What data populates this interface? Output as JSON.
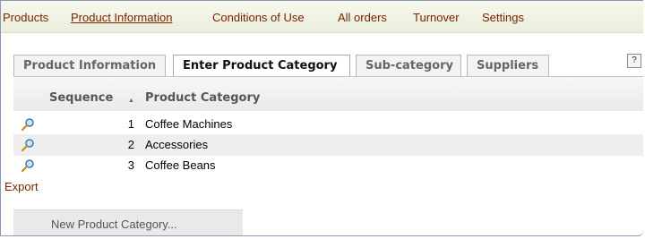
{
  "topnav": {
    "items": [
      {
        "label": "Products"
      },
      {
        "label": "Product Information"
      },
      {
        "label": "Conditions of Use"
      },
      {
        "label": "All orders"
      },
      {
        "label": "Turnover"
      },
      {
        "label": "Settings"
      }
    ],
    "active": "Product Information"
  },
  "tabs": [
    {
      "label": "Product Information"
    },
    {
      "label": "Enter Product Category"
    },
    {
      "label": "Sub-category"
    },
    {
      "label": "Suppliers"
    }
  ],
  "active_tab": "Enter Product Category",
  "help_label": "?",
  "table": {
    "columns": [
      {
        "label": "Sequence"
      },
      {
        "label": "Product Category"
      }
    ],
    "sort": {
      "column": "Sequence",
      "direction": "ascending"
    },
    "rows": [
      {
        "sequence": "1",
        "category": "Coffee Machines"
      },
      {
        "sequence": "2",
        "category": "Accessories"
      },
      {
        "sequence": "3",
        "category": "Coffee Beans"
      }
    ]
  },
  "export_label": "Export",
  "new_button_label": "New Product Category...",
  "colors": {
    "link": "#7a2200",
    "nav_bg": "#eef1e0"
  }
}
